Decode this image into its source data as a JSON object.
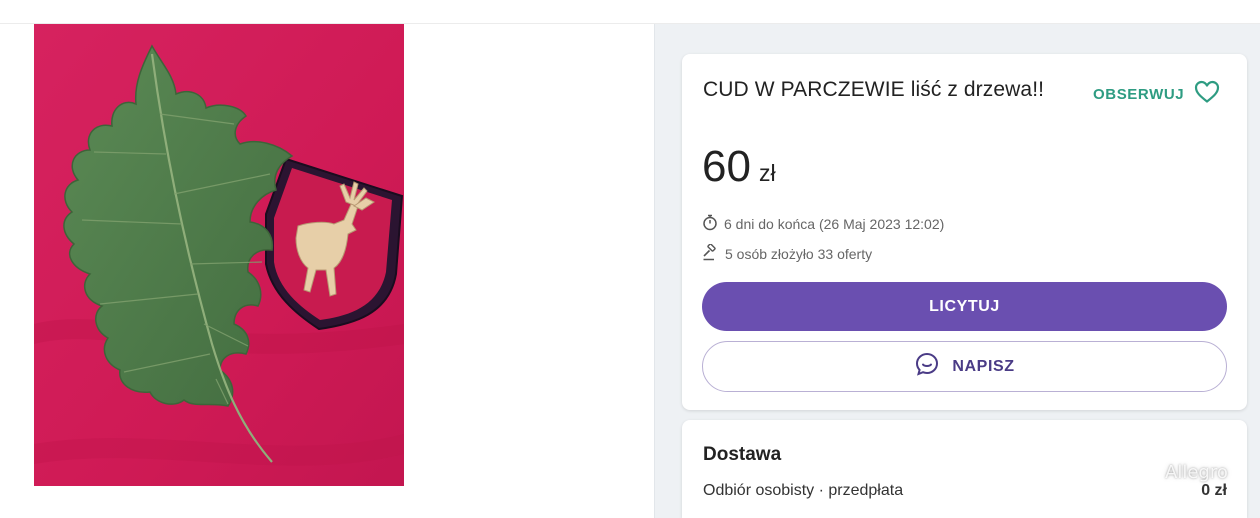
{
  "listing": {
    "title": "CUD W PARCZEWIE liść z drzewa!!",
    "watch_label": "OBSERWUJ",
    "price_amount": "60",
    "price_currency": "zł",
    "time_left": "6 dni do końca (26 Maj 2023 12:02)",
    "bids_info": "5 osób złożyło 33 oferty",
    "bid_button_label": "LICYTUJ",
    "message_button_label": "NAPISZ"
  },
  "delivery": {
    "title": "Dostawa",
    "option_label": "Odbiór osobisty · przedpłata",
    "option_price": "0 zł"
  },
  "watermark": "Allegro",
  "icons": {
    "watch": "heart-icon",
    "time": "stopwatch-icon",
    "bids": "gavel-icon",
    "message": "chat-bubble-icon"
  },
  "colors": {
    "accent_green": "#2e9c82",
    "bid_button": "#6a4fb0",
    "message_text": "#4a3b86",
    "panel_background": "#eef1f4",
    "photo_fabric": "#d21b57",
    "leaf": "#4f7b4a"
  }
}
